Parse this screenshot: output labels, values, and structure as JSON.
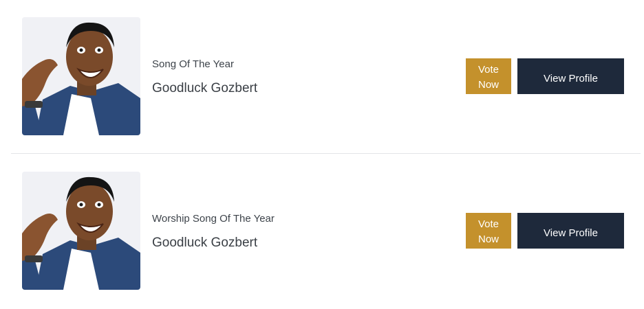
{
  "nominees": [
    {
      "category": "Song Of The Year",
      "name": "Goodluck Gozbert",
      "vote_label_line1": "Vote",
      "vote_label_line2": "Now",
      "profile_label": "View Profile"
    },
    {
      "category": "Worship Song Of The Year",
      "name": "Goodluck Gozbert",
      "vote_label_line1": "Vote",
      "vote_label_line2": "Now",
      "profile_label": "View Profile"
    }
  ],
  "colors": {
    "vote_button": "#c4912c",
    "profile_button": "#1e293b",
    "divider": "#e3e5e8"
  }
}
